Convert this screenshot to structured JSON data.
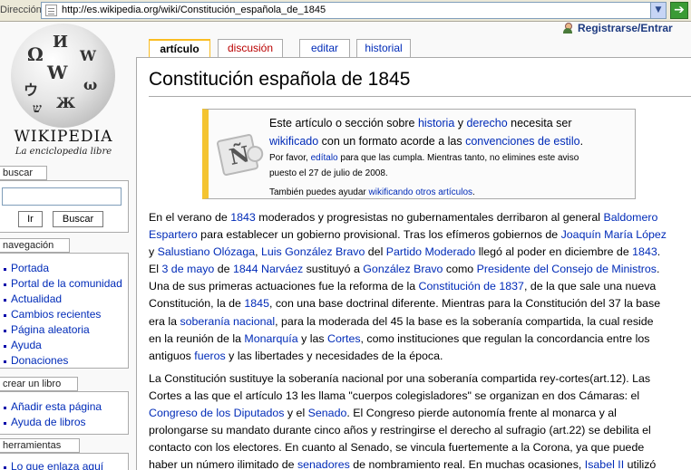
{
  "address_bar": {
    "label": "Dirección",
    "url": "http://es.wikipedia.org/wiki/Constitución_española_de_1845"
  },
  "logo": {
    "wordmark": "WIKIPEDIA",
    "tagline": "La enciclopedia libre"
  },
  "search": {
    "title": "buscar",
    "go_label": "Ir",
    "search_label": "Buscar"
  },
  "navigation": {
    "title": "navegación",
    "items": [
      "Portada",
      "Portal de la comunidad",
      "Actualidad",
      "Cambios recientes",
      "Página aleatoria",
      "Ayuda",
      "Donaciones"
    ]
  },
  "book": {
    "title": "crear un libro",
    "items": [
      "Añadir esta página",
      "Ayuda de libros"
    ]
  },
  "tools": {
    "title": "herramientas",
    "items": [
      "Lo que enlaza aquí"
    ]
  },
  "tabs": {
    "article": "artículo",
    "discussion": "discusión",
    "edit": "editar",
    "history": "historial"
  },
  "user_link": "Registrarse/Entrar",
  "page_title": "Constitución española de 1845",
  "notice": {
    "line1": [
      {
        "t": "Este artículo o sección sobre "
      },
      {
        "t": "historia",
        "link": true
      },
      {
        "t": " y "
      },
      {
        "t": "derecho",
        "link": true
      },
      {
        "t": " necesita ser"
      }
    ],
    "line2": [
      {
        "t": "wikificado",
        "link": true
      },
      {
        "t": " con un formato acorde a las "
      },
      {
        "t": "convenciones de estilo",
        "link": true
      },
      {
        "t": "."
      }
    ],
    "line3": [
      {
        "t": "Por favor, "
      },
      {
        "t": "edítalo",
        "link": true
      },
      {
        "t": " para que las cumpla. Mientras tanto, no elimines este aviso"
      }
    ],
    "line4": [
      {
        "t": "puesto el 27 de julio de 2008."
      }
    ],
    "line5": [
      {
        "t": "También puedes ayudar "
      },
      {
        "t": "wikificando otros artículos",
        "link": true
      },
      {
        "t": "."
      }
    ]
  },
  "paragraphs": [
    [
      [
        {
          "t": "En el verano de "
        },
        {
          "t": "1843",
          "link": true
        },
        {
          "t": " moderados y progresistas no gubernamentales derribaron al general "
        },
        {
          "t": "Baldomero",
          "link": true
        }
      ],
      [
        {
          "t": "Espartero",
          "link": true
        },
        {
          "t": " para establecer un gobierno provisional. Tras los efímeros gobiernos de "
        },
        {
          "t": "Joaquín María López",
          "link": true
        }
      ],
      [
        {
          "t": "y "
        },
        {
          "t": "Salustiano Olózaga",
          "link": true
        },
        {
          "t": ", "
        },
        {
          "t": "Luis González Bravo",
          "link": true
        },
        {
          "t": " del "
        },
        {
          "t": "Partido Moderado",
          "link": true
        },
        {
          "t": " llegó al poder en diciembre de "
        },
        {
          "t": "1843",
          "link": true
        },
        {
          "t": "."
        }
      ],
      [
        {
          "t": "El "
        },
        {
          "t": "3 de mayo",
          "link": true
        },
        {
          "t": " de "
        },
        {
          "t": "1844",
          "link": true
        },
        {
          "t": " "
        },
        {
          "t": "Narváez",
          "link": true
        },
        {
          "t": " sustituyó a "
        },
        {
          "t": "González Bravo",
          "link": true
        },
        {
          "t": " como "
        },
        {
          "t": "Presidente del Consejo de Ministros",
          "link": true
        },
        {
          "t": "."
        }
      ],
      [
        {
          "t": "Una de sus primeras actuaciones fue la reforma de la "
        },
        {
          "t": "Constitución de 1837",
          "link": true
        },
        {
          "t": ", de la que sale una nueva"
        }
      ],
      [
        {
          "t": "Constitución, la de "
        },
        {
          "t": "1845",
          "link": true
        },
        {
          "t": ", con una base doctrinal diferente. Mientras para la Constitución del 37 la base"
        }
      ],
      [
        {
          "t": "era la "
        },
        {
          "t": "soberanía nacional",
          "link": true
        },
        {
          "t": ", para la moderada del 45 la base es la soberanía compartida, la cual reside"
        }
      ],
      [
        {
          "t": "en la reunión de la "
        },
        {
          "t": "Monarquía",
          "link": true
        },
        {
          "t": " y las "
        },
        {
          "t": "Cortes",
          "link": true
        },
        {
          "t": ", como instituciones que regulan la concordancia entre los"
        }
      ],
      [
        {
          "t": "antiguos "
        },
        {
          "t": "fueros",
          "link": true
        },
        {
          "t": " y las libertades y necesidades de la época."
        }
      ]
    ],
    [
      [
        {
          "t": "La Constitución sustituye la soberanía nacional por una soberanía compartida rey-cortes(art.12). Las"
        }
      ],
      [
        {
          "t": "Cortes a las que el artículo 13 les llama \"cuerpos colegisladores\" se organizan en dos Cámaras: el"
        }
      ],
      [
        {
          "t": "Congreso de los Diputados",
          "link": true
        },
        {
          "t": " y el "
        },
        {
          "t": "Senado",
          "link": true
        },
        {
          "t": ". El Congreso pierde autonomía frente al monarca y al"
        }
      ],
      [
        {
          "t": "prolongarse su mandato durante cinco años y restringirse el derecho al sufragio (art.22) se debilita el"
        }
      ],
      [
        {
          "t": "contacto con los electores. En cuanto al Senado, se vincula fuertemente a la Corona, ya que puede"
        }
      ],
      [
        {
          "t": "haber un número ilimitado de "
        },
        {
          "t": "senadores",
          "link": true
        },
        {
          "t": " de nombramiento real. En muchas ocasiones, "
        },
        {
          "t": "Isabel II",
          "link": true
        },
        {
          "t": " utilizó"
        }
      ]
    ]
  ]
}
